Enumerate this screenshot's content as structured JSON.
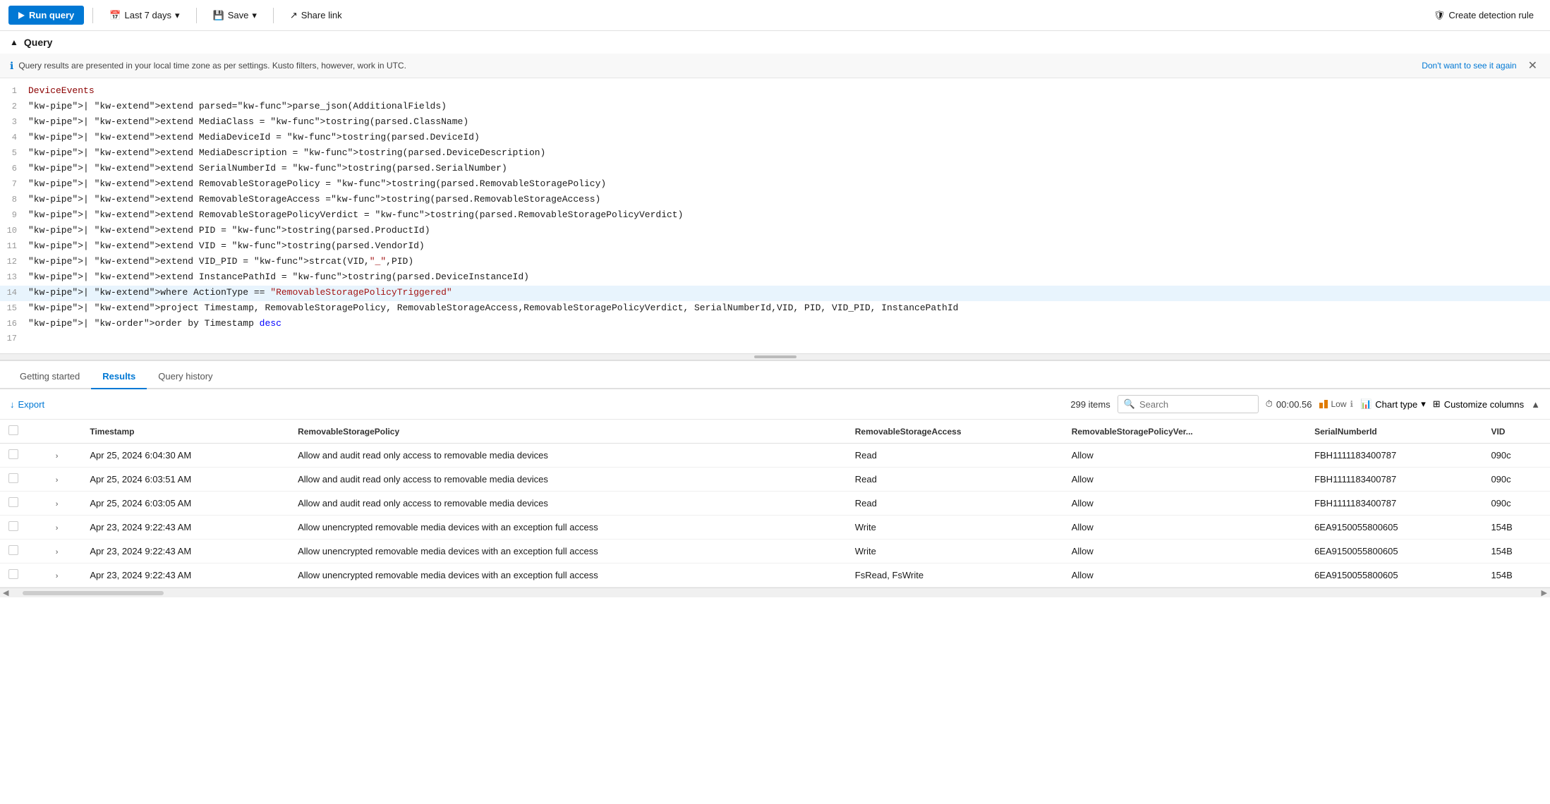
{
  "toolbar": {
    "run_label": "Run query",
    "last_days_label": "Last 7 days",
    "save_label": "Save",
    "share_label": "Share link",
    "create_detection_label": "Create detection rule"
  },
  "query_section": {
    "title": "Query",
    "info_message": "Query results are presented in your local time zone as per settings. Kusto filters, however, work in UTC.",
    "dont_show_label": "Don't want to see it again"
  },
  "code_lines": [
    {
      "num": 1,
      "content": "DeviceEvents"
    },
    {
      "num": 2,
      "content": "| extend parsed=parse_json(AdditionalFields)"
    },
    {
      "num": 3,
      "content": "| extend MediaClass = tostring(parsed.ClassName)"
    },
    {
      "num": 4,
      "content": "| extend MediaDeviceId = tostring(parsed.DeviceId)"
    },
    {
      "num": 5,
      "content": "| extend MediaDescription = tostring(parsed.DeviceDescription)"
    },
    {
      "num": 6,
      "content": "| extend SerialNumberId = tostring(parsed.SerialNumber)"
    },
    {
      "num": 7,
      "content": "| extend RemovableStoragePolicy = tostring(parsed.RemovableStoragePolicy)"
    },
    {
      "num": 8,
      "content": "| extend RemovableStorageAccess =tostring(parsed.RemovableStorageAccess)"
    },
    {
      "num": 9,
      "content": "| extend RemovableStoragePolicyVerdict = tostring(parsed.RemovableStoragePolicyVerdict)"
    },
    {
      "num": 10,
      "content": "| extend PID = tostring(parsed.ProductId)"
    },
    {
      "num": 11,
      "content": "| extend VID = tostring(parsed.VendorId)"
    },
    {
      "num": 12,
      "content": "| extend VID_PID = strcat(VID,\"_\",PID)"
    },
    {
      "num": 13,
      "content": "| extend InstancePathId = tostring(parsed.DeviceInstanceId)"
    },
    {
      "num": 14,
      "content": "| where ActionType == \"RemovableStoragePolicyTriggered\"",
      "highlight": true
    },
    {
      "num": 15,
      "content": "| project Timestamp, RemovableStoragePolicy, RemovableStorageAccess,RemovableStoragePolicyVerdict, SerialNumberId,VID, PID, VID_PID, InstancePathId"
    },
    {
      "num": 16,
      "content": "| order by Timestamp desc"
    },
    {
      "num": 17,
      "content": ""
    }
  ],
  "tabs": [
    {
      "id": "getting-started",
      "label": "Getting started",
      "active": false
    },
    {
      "id": "results",
      "label": "Results",
      "active": true
    },
    {
      "id": "query-history",
      "label": "Query history",
      "active": false
    }
  ],
  "results_toolbar": {
    "export_label": "Export",
    "count": "299 items",
    "search_placeholder": "Search",
    "timer": "00:00.56",
    "low_label": "Low",
    "chart_type_label": "Chart type",
    "customize_label": "Customize columns"
  },
  "table": {
    "columns": [
      "",
      "",
      "Timestamp",
      "RemovableStoragePolicy",
      "RemovableStorageAccess",
      "RemovableStoragePolicyVer...",
      "SerialNumberId",
      "VID"
    ],
    "rows": [
      {
        "timestamp": "Apr 25, 2024 6:04:30 AM",
        "policy": "Allow and audit read only access to removable media devices",
        "access": "Read",
        "verdict": "Allow",
        "serial": "FBH1111183400787",
        "vid": "090c"
      },
      {
        "timestamp": "Apr 25, 2024 6:03:51 AM",
        "policy": "Allow and audit read only access to removable media devices",
        "access": "Read",
        "verdict": "Allow",
        "serial": "FBH1111183400787",
        "vid": "090c"
      },
      {
        "timestamp": "Apr 25, 2024 6:03:05 AM",
        "policy": "Allow and audit read only access to removable media devices",
        "access": "Read",
        "verdict": "Allow",
        "serial": "FBH1111183400787",
        "vid": "090c"
      },
      {
        "timestamp": "Apr 23, 2024 9:22:43 AM",
        "policy": "Allow unencrypted removable media devices with an exception full access",
        "access": "Write",
        "verdict": "Allow",
        "serial": "6EA9150055800605",
        "vid": "154B"
      },
      {
        "timestamp": "Apr 23, 2024 9:22:43 AM",
        "policy": "Allow unencrypted removable media devices with an exception full access",
        "access": "Write",
        "verdict": "Allow",
        "serial": "6EA9150055800605",
        "vid": "154B"
      },
      {
        "timestamp": "Apr 23, 2024 9:22:43 AM",
        "policy": "Allow unencrypted removable media devices with an exception full access",
        "access": "FsRead, FsWrite",
        "verdict": "Allow",
        "serial": "6EA9150055800605",
        "vid": "154B"
      }
    ]
  }
}
